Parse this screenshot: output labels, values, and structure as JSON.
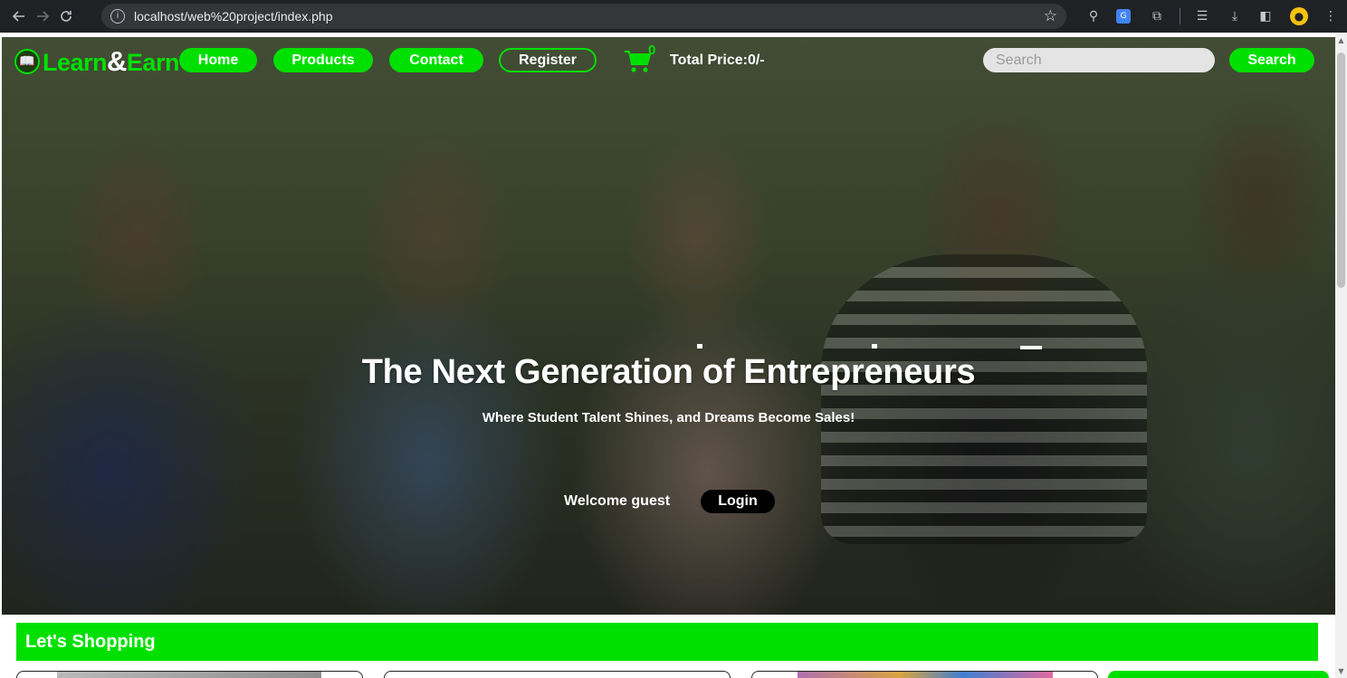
{
  "browser": {
    "url": "localhost/web%20project/index.php",
    "back_icon": "arrow-left-icon",
    "forward_icon": "arrow-right-icon",
    "reload_icon": "reload-icon"
  },
  "brand": {
    "name_part1": "Learn",
    "name_amp": "&",
    "name_part2": "Earn",
    "accent_color": "#00e000"
  },
  "nav": {
    "home": "Home",
    "products": "Products",
    "contact": "Contact",
    "register": "Register"
  },
  "cart": {
    "count": "0",
    "total_price": "Total Price:0/-"
  },
  "search": {
    "placeholder": "Search",
    "button_label": "Search"
  },
  "hero": {
    "headline": "The Next Generation of Entrepreneurs",
    "subline": "Where Student Talent Shines, and Dreams Become Sales!",
    "welcome": "Welcome guest",
    "login_label": "Login"
  },
  "section": {
    "title": "Let's Shopping"
  }
}
